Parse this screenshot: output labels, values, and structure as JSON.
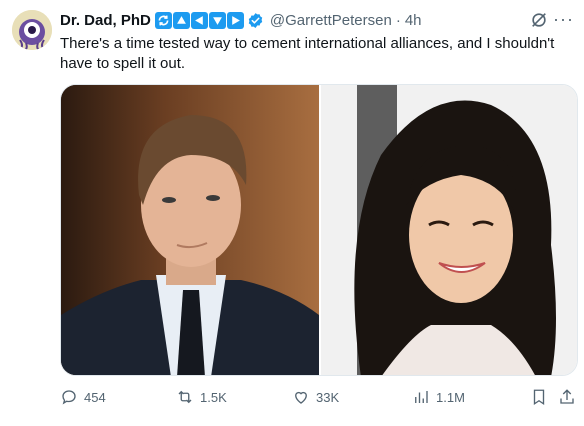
{
  "author": {
    "display_name": "Dr. Dad, PhD",
    "handle": "@GarrettPetersen",
    "separator": "·",
    "time": "4h",
    "badge_icons": [
      "sync-icon",
      "arrow-up-icon",
      "arrow-left-icon",
      "arrow-down-icon",
      "arrow-right-icon"
    ],
    "verified": true
  },
  "tweet": {
    "text": "There's a time tested way to cement international alliances, and I shouldn't have to spell it out."
  },
  "media": {
    "count": 2,
    "images": [
      "young man in dark suit and tie",
      "young woman with long dark hair smiling"
    ]
  },
  "actions": {
    "replies": "454",
    "retweets": "1.5K",
    "likes": "33K",
    "views": "1.1M"
  },
  "colors": {
    "accent": "#1d9bf0",
    "text_primary": "#0f1419",
    "text_secondary": "#536471"
  }
}
